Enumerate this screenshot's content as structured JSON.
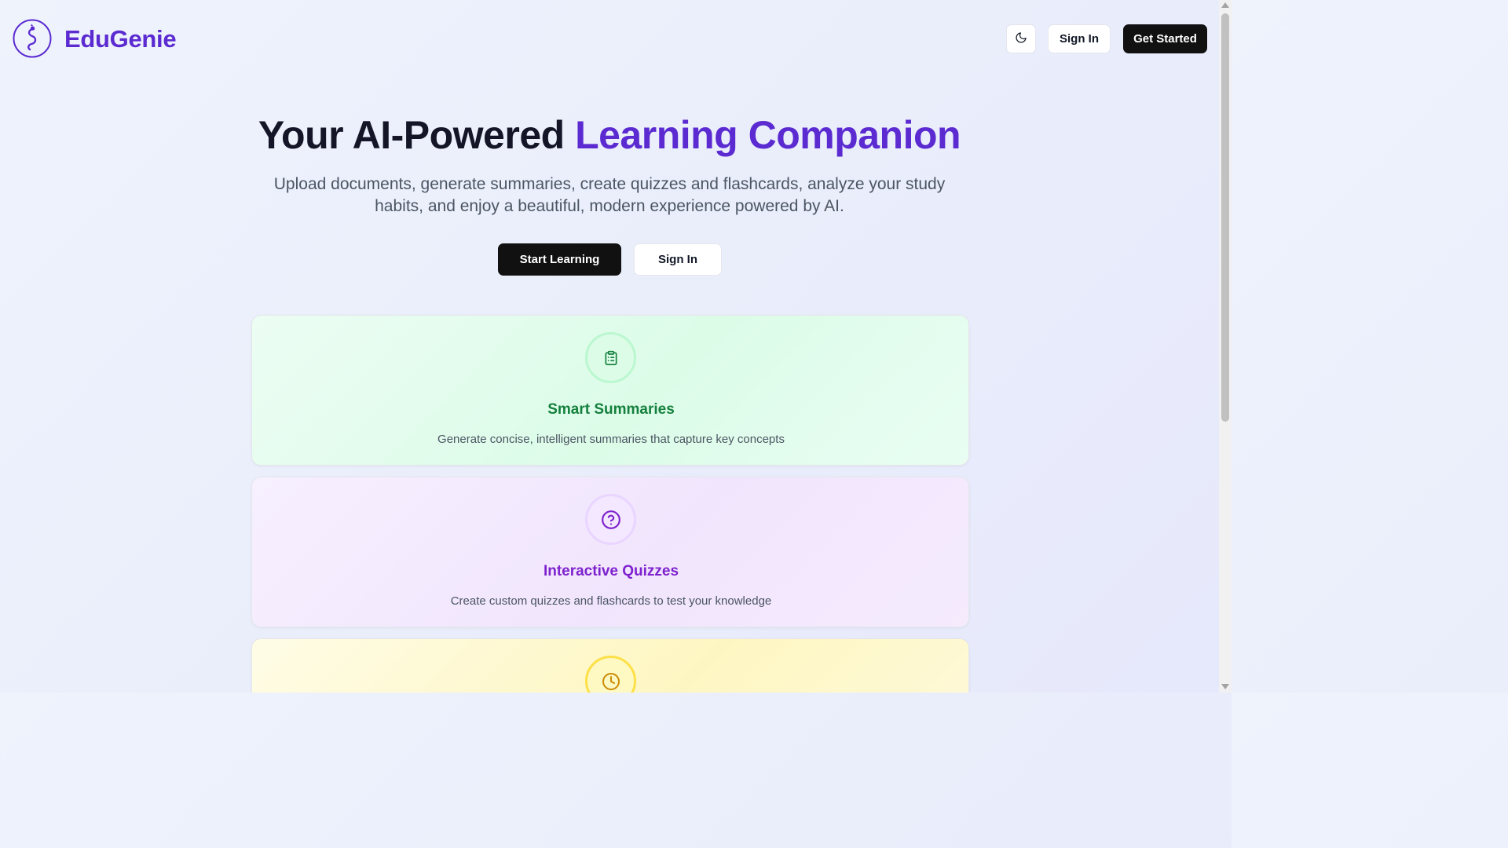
{
  "header": {
    "brand": "EduGenie",
    "theme_toggle_icon": "moon-icon",
    "sign_in_label": "Sign In",
    "get_started_label": "Get Started"
  },
  "hero": {
    "title_main": "Your AI-Powered",
    "title_accent": "Learning Companion",
    "subtitle": "Upload documents, generate summaries, create quizzes and flashcards, analyze your study habits, and enjoy a beautiful, modern experience powered by AI.",
    "start_label": "Start Learning",
    "sign_in_label": "Sign In"
  },
  "features": [
    {
      "icon": "clipboard-list-icon",
      "title": "Smart Summaries",
      "description": "Generate concise, intelligent summaries that capture key concepts",
      "color": "#15803d"
    },
    {
      "icon": "help-circle-icon",
      "title": "Interactive Quizzes",
      "description": "Create custom quizzes and flashcards to test your knowledge",
      "color": "#7e22ce"
    },
    {
      "icon": "clock-icon",
      "title": "",
      "description": "",
      "color": "#ca8a04"
    }
  ],
  "colors": {
    "brand": "#5b2bd1",
    "primary_button": "#111111"
  }
}
